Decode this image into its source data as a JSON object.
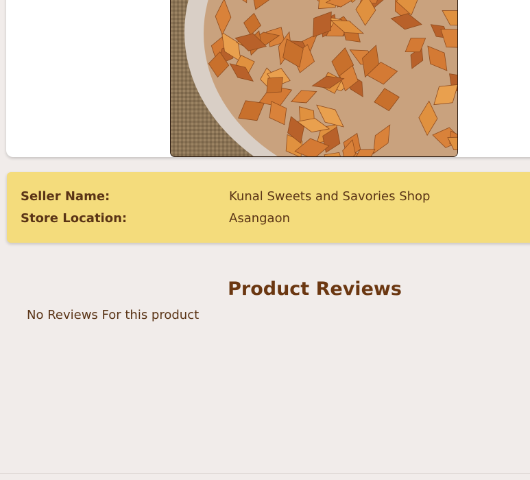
{
  "product": {
    "image_description": "bowl of diamond-shaped fried snack pieces"
  },
  "seller": {
    "name_label": "Seller Name:",
    "name_value": "Kunal Sweets and Savories Shop",
    "location_label": "Store Location:",
    "location_value": "Asangaon"
  },
  "reviews": {
    "title": "Product Reviews",
    "empty_text": "No Reviews For this product"
  },
  "colors": {
    "background": "#f1ecea",
    "seller_panel": "#f4dc7c",
    "heading_brown": "#6b3711",
    "text_brown": "#5a3416"
  }
}
